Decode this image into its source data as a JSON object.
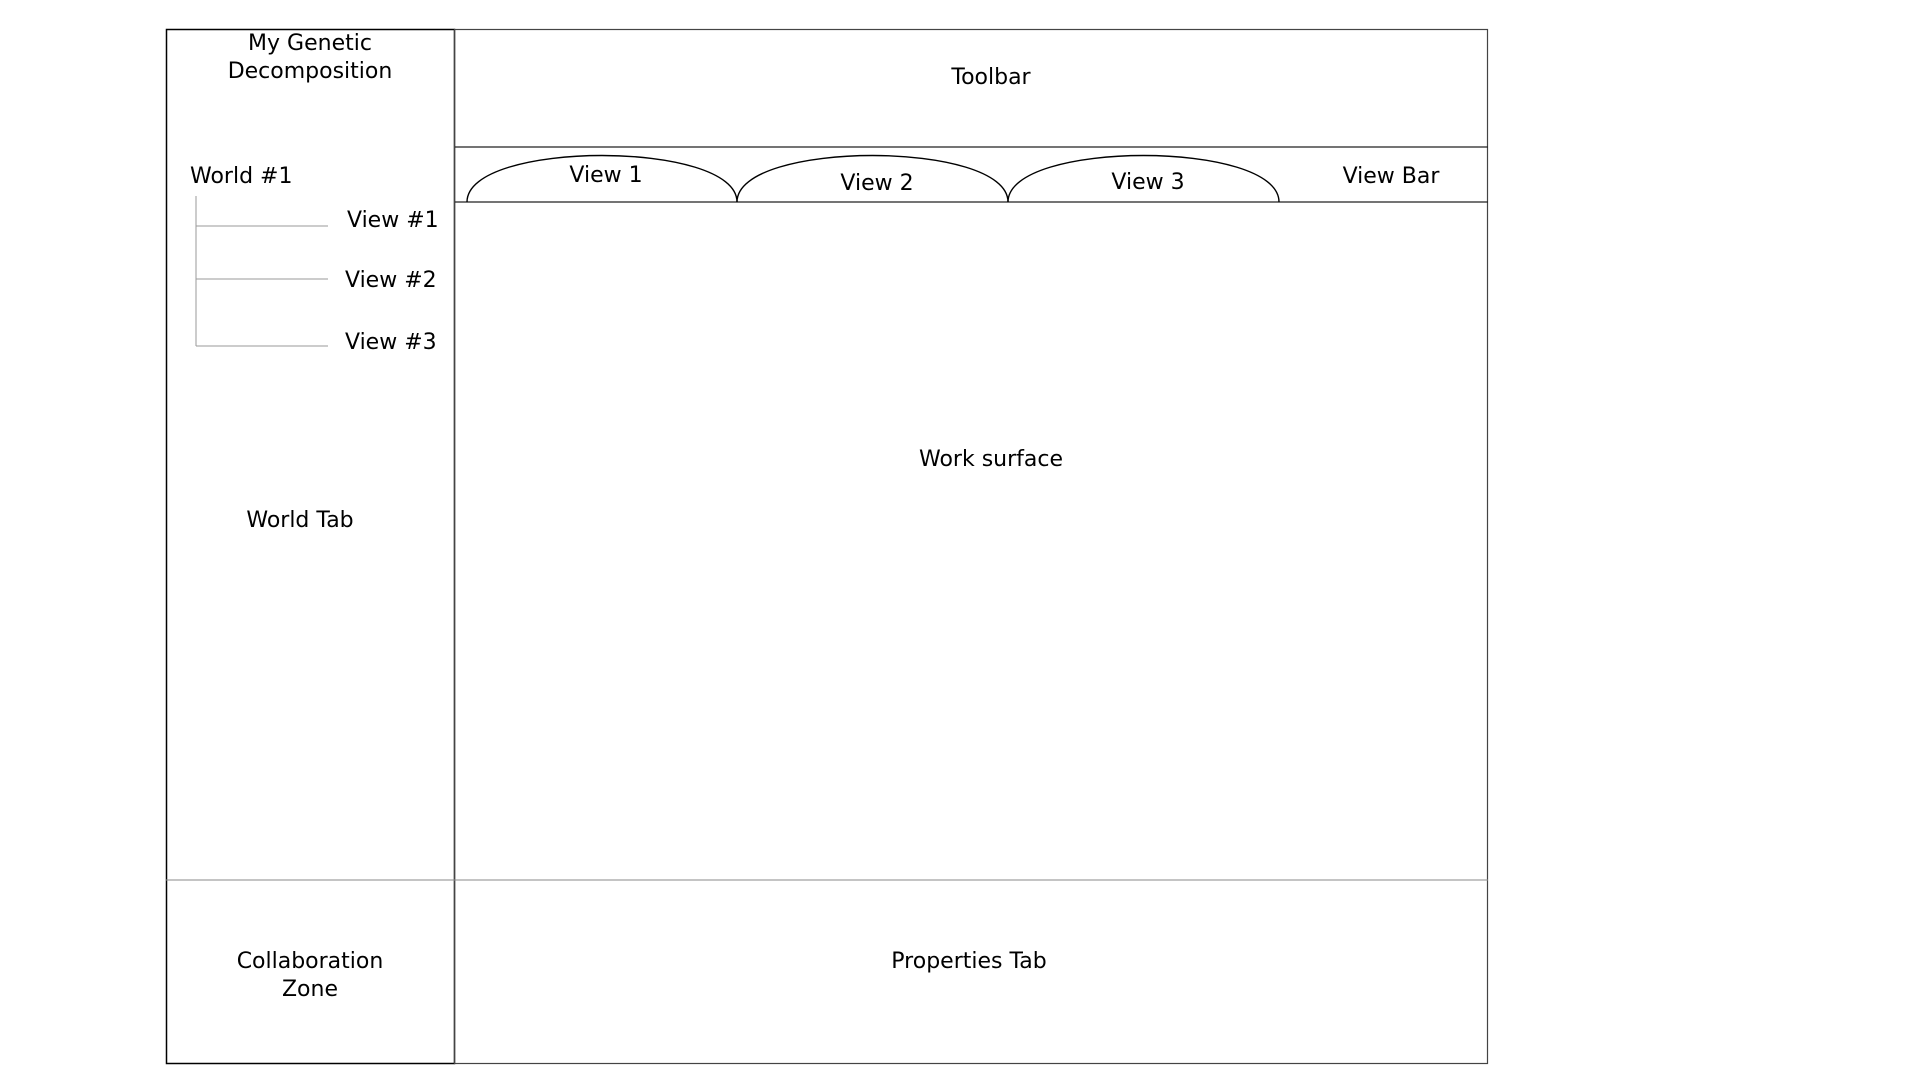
{
  "sidebar": {
    "title_line1": "My Genetic",
    "title_line2": "Decomposition",
    "world": "World #1",
    "views": [
      "View #1",
      "View #2",
      "View #3"
    ],
    "world_tab": "World Tab",
    "collab_line1": "Collaboration",
    "collab_line2": "Zone"
  },
  "toolbar": {
    "label": "Toolbar"
  },
  "viewbar": {
    "tabs": [
      "View 1",
      "View 2",
      "View 3"
    ],
    "label": "View Bar"
  },
  "work_surface": {
    "label": "Work surface"
  },
  "properties": {
    "label": "Properties Tab"
  },
  "colors": {
    "stroke": "#000000",
    "tree_line": "#9a9a9a",
    "divider": "#8a8a8a",
    "background": "#ffffff"
  }
}
